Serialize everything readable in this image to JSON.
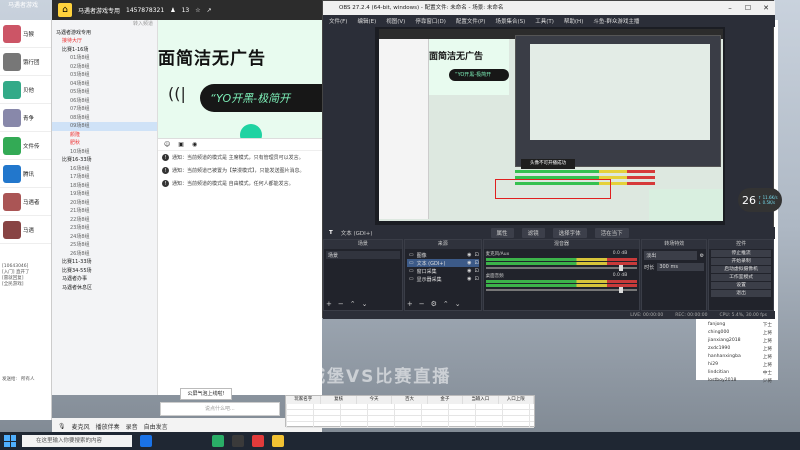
{
  "desktop": {
    "top_title": "马遇者游戏"
  },
  "chat": {
    "items": [
      {
        "name": "马猴",
        "color": "#c56"
      },
      {
        "name": "饿行团",
        "color": "#777"
      },
      {
        "name": "贝他",
        "color": "#3a8"
      },
      {
        "name": "青争",
        "color": "#88a"
      },
      {
        "name": "文件传",
        "color": "#3a5"
      },
      {
        "name": "腾讯",
        "color": "#27c"
      },
      {
        "name": "马遇者",
        "color": "#a55"
      },
      {
        "name": "马遇",
        "color": "#844"
      }
    ],
    "snippets": [
      "[10643046]",
      "[入门] 直开了",
      "[雷就回复]",
      "[全民游戏]"
    ],
    "footer_labels": [
      "发送给:",
      "所有人"
    ]
  },
  "yy": {
    "title": "马遇者游戏专用",
    "id": "1457878321",
    "count": "13",
    "tree_header": "转入频道",
    "tree": [
      {
        "label": "马遇者游戏专用",
        "level": 0
      },
      {
        "label": "接待大厅",
        "level": 1,
        "red": true
      },
      {
        "label": "比赛1-16场",
        "level": 1
      },
      {
        "label": "01场8组",
        "level": 2
      },
      {
        "label": "02场8组",
        "level": 2
      },
      {
        "label": "03场8组",
        "level": 2
      },
      {
        "label": "04场8组",
        "level": 2
      },
      {
        "label": "05场8组",
        "level": 2
      },
      {
        "label": "06场8组",
        "level": 2
      },
      {
        "label": "07场8组",
        "level": 2
      },
      {
        "label": "08场8组",
        "level": 2
      },
      {
        "label": "09场8组",
        "level": 2,
        "active": true
      },
      {
        "label": "颜隆",
        "level": 2,
        "red": true
      },
      {
        "label": "肥秋",
        "level": 2,
        "red": true
      },
      {
        "label": "10场8组",
        "level": 2
      },
      {
        "label": "比赛16-33场",
        "level": 1
      },
      {
        "label": "16场8组",
        "level": 2
      },
      {
        "label": "17场8组",
        "level": 2
      },
      {
        "label": "18场8组",
        "level": 2
      },
      {
        "label": "19场8组",
        "level": 2
      },
      {
        "label": "20场8组",
        "level": 2
      },
      {
        "label": "21场8组",
        "level": 2
      },
      {
        "label": "22场8组",
        "level": 2
      },
      {
        "label": "23场8组",
        "level": 2
      },
      {
        "label": "24场8组",
        "level": 2
      },
      {
        "label": "25场8组",
        "level": 2
      },
      {
        "label": "26场8组",
        "level": 2
      },
      {
        "label": "比赛11-33场",
        "level": 1
      },
      {
        "label": "比赛34-55场",
        "level": 1
      },
      {
        "label": "马遇者办事",
        "level": 1
      },
      {
        "label": "马遇者休息区",
        "level": 1
      }
    ],
    "banner": {
      "headline": "面简洁无广告",
      "pill": "“YO开黑-极简开",
      "icon": "((|"
    },
    "messages": [
      "通知：当前频道的模式是 主席模式，只有管理员可以发言。",
      "通知：当前频道已被置为【禁漫模式】，只能发送图片消息。",
      "通知：当前频道的模式是 自由模式，任何人都能发言。"
    ],
    "input_popup": "公屏气泡上线啦!",
    "input_placeholder": "说点什么吧...",
    "controls": [
      "麦克风",
      "播放伴奏",
      "录音",
      "自由发言"
    ]
  },
  "userlist": {
    "rows": [
      {
        "name": "fanjong",
        "role": "下士"
      },
      {
        "name": "ching000",
        "role": "上将"
      },
      {
        "name": "jianxiang2018",
        "role": "上将"
      },
      {
        "name": "zxdc1990",
        "role": "上将"
      },
      {
        "name": "hanhanxingba",
        "role": "上将"
      },
      {
        "name": "hi29",
        "role": "上将"
      },
      {
        "name": "lindcitian",
        "role": "中士"
      },
      {
        "name": "lostboy2018",
        "role": "少将"
      }
    ],
    "buttons": [
      "停止推流",
      "开始录制",
      "启动虚拟摄像机",
      "工作室模式",
      "设置",
      "退出"
    ]
  },
  "sheet": {
    "columns": [
      "玩家名字",
      "复核",
      "今天",
      "百大",
      "金子",
      "当输入口",
      "入口上限"
    ]
  },
  "overlay": {
    "watermark": "地下城堡VS比赛直播",
    "fps_value": "26",
    "fps_unit": "↑ 11.6K/s",
    "fps_unit2": "↓ 0.5K/s"
  },
  "obs": {
    "title": "OBS 27.2.4 (64-bit, windows) - 配置文件: 未命名 - 场景: 未命名",
    "menu": [
      "文件(F)",
      "编辑(E)",
      "视图(V)",
      "停靠窗口(D)",
      "配置文件(P)",
      "场景集合(S)",
      "工具(T)",
      "帮助(H)",
      "斗鱼-群众游戏主播"
    ],
    "preview_toast": "头像不可开播成功",
    "srcbar": {
      "icon": "T",
      "name": "文本 (GDI+)",
      "btn_props": "属性",
      "btn_filter": "滤镜",
      "btn_font": "选择字体",
      "btn_text": "活在当下"
    },
    "docks": {
      "scenes": {
        "header": "场景",
        "items": [
          "场景"
        ]
      },
      "sources": {
        "header": "来源",
        "items": [
          "图像",
          "文本 (GDI+)",
          "窗口采集",
          "显示器采集"
        ],
        "selected": 1
      },
      "mixer": {
        "header": "混音器",
        "channels": [
          {
            "name": "麦克风/Aux",
            "db": "0.0 dB"
          },
          {
            "name": "桌面音频",
            "db": "0.0 dB"
          }
        ]
      },
      "transitions": {
        "header": "转场特效",
        "type": "淡出",
        "duration_label": "时长",
        "duration": "300 ms"
      },
      "controls": {
        "header": "控件",
        "buttons": [
          "停止推流",
          "开始录制",
          "启动虚拟摄像机",
          "工作室模式",
          "设置",
          "退出"
        ]
      }
    },
    "status": [
      "LIVE: 00:00:00",
      "REC: 00:00:00",
      "CPU: 5.4%, 30.00 fps"
    ]
  },
  "taskbar": {
    "search_placeholder": "在这里输入你要搜索的内容"
  }
}
